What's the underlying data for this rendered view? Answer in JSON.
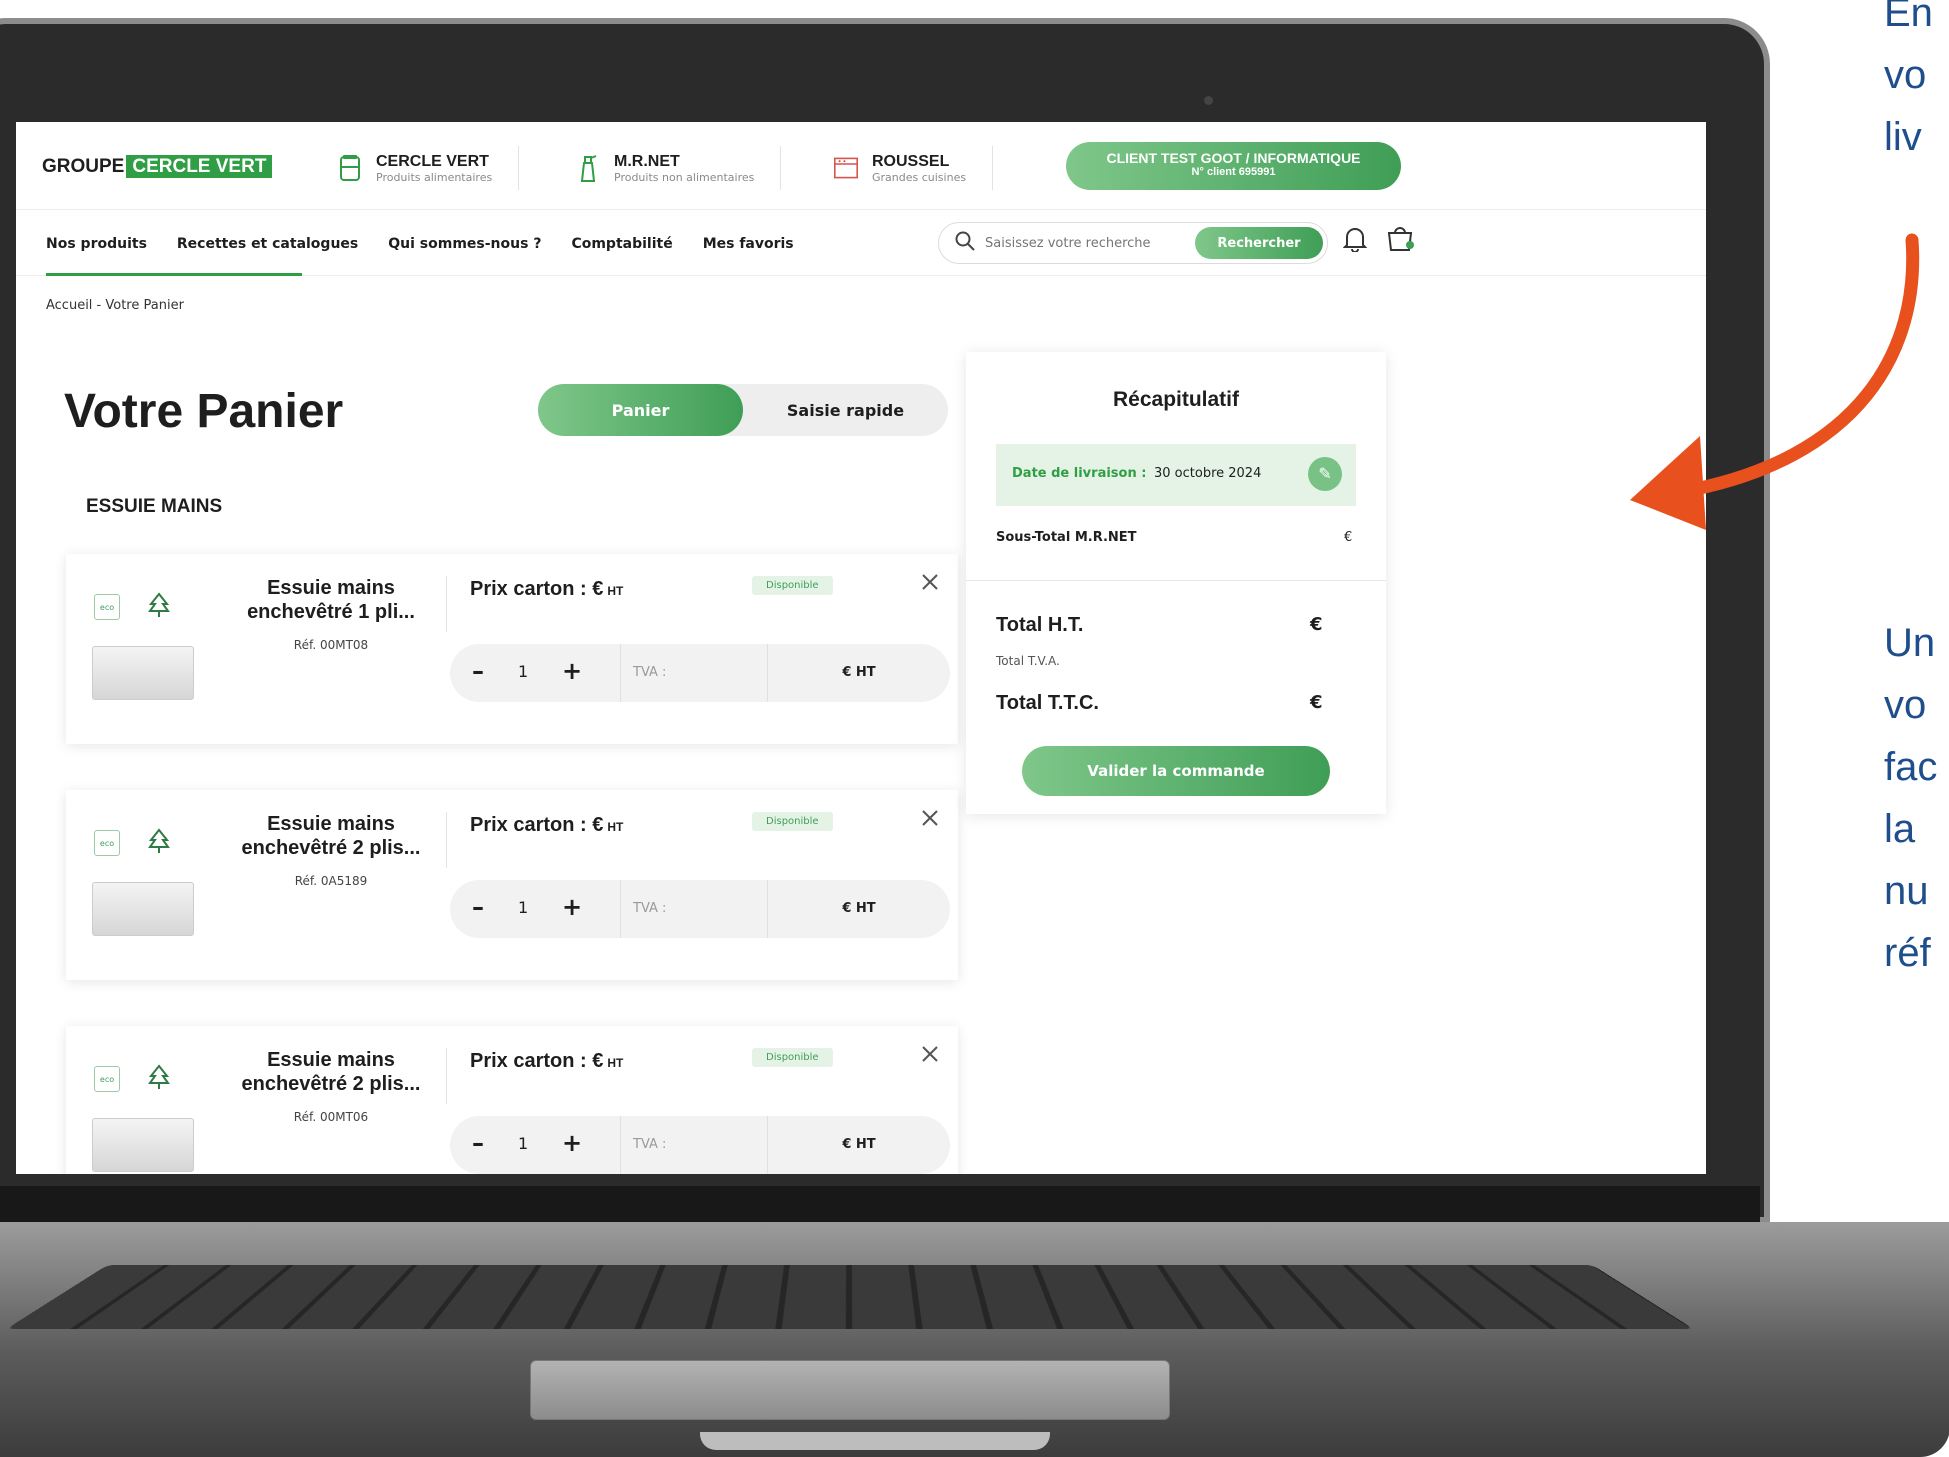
{
  "header": {
    "logo_prefix": "GROUPE",
    "logo_highlight": "CERCLE VERT",
    "brands": [
      {
        "name": "CERCLE VERT",
        "subtitle": "Produits alimentaires"
      },
      {
        "name": "M.R.NET",
        "subtitle": "Produits non alimentaires"
      },
      {
        "name": "ROUSSEL",
        "subtitle": "Grandes cuisines"
      }
    ],
    "client_name": "CLIENT TEST GOOT / INFORMATIQUE",
    "client_number": "N° client 695991"
  },
  "nav": {
    "links": [
      "Nos produits",
      "Recettes et catalogues",
      "Qui sommes-nous ?",
      "Comptabilité",
      "Mes favoris"
    ],
    "search_placeholder": "Saisissez votre recherche",
    "search_button": "Rechercher"
  },
  "breadcrumb": "Accueil  -  Votre Panier",
  "page": {
    "title": "Votre Panier",
    "tabs": [
      "Panier",
      "Saisie rapide"
    ],
    "section": "ESSUIE MAINS"
  },
  "products": [
    {
      "name": "Essuie mains enchevêtré 1 pli...",
      "ref": "Réf. 00MT08",
      "price_label": "Prix carton :",
      "price": "",
      "unit": "HT",
      "status": "Disponible",
      "qty": "1",
      "tva": "TVA :",
      "total": "€ HT"
    },
    {
      "name": "Essuie mains enchevêtré 2 plis...",
      "ref": "Réf. 0A5189",
      "price_label": "Prix carton :",
      "price": "",
      "unit": "HT",
      "status": "Disponible",
      "qty": "1",
      "tva": "TVA :",
      "total": "€ HT"
    },
    {
      "name": "Essuie mains enchevêtré 2 plis...",
      "ref": "Réf. 00MT06",
      "price_label": "Prix carton :",
      "price": "",
      "unit": "HT",
      "status": "Disponible",
      "qty": "1",
      "tva": "TVA :",
      "total": "€ HT"
    }
  ],
  "summary": {
    "title": "Récapitulatif",
    "delivery_label": "Date de livraison :",
    "delivery_date": "30 octobre 2024",
    "subtotal_label": "Sous-Total M.R.NET",
    "subtotal_value": "€",
    "total_ht_label": "Total H.T.",
    "total_ht_value": "€",
    "tva_label": "Total T.V.A.",
    "total_ttc_label": "Total T.T.C.",
    "total_ttc_value": "€",
    "validate_button": "Valider la commande"
  },
  "captions": {
    "top": [
      "En",
      "vo",
      "liv"
    ],
    "bottom": [
      "Un",
      "vo",
      "fac",
      "la",
      "nu",
      "réf"
    ]
  },
  "colors": {
    "accent": "#3f9e56",
    "caption": "#1f4e8c",
    "arrow": "#e8501e"
  }
}
